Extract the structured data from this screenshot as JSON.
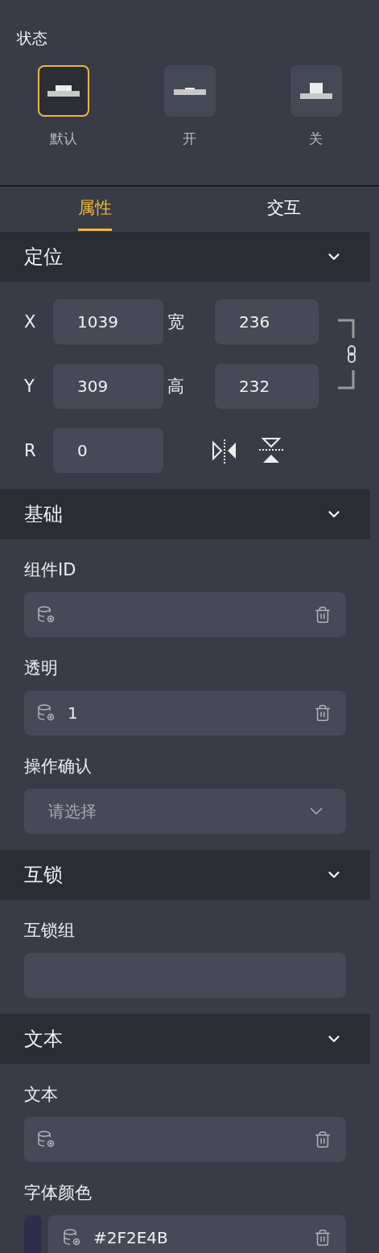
{
  "state_panel": {
    "title": "状态",
    "states": [
      {
        "kind": "default",
        "label": "默认",
        "selected": true
      },
      {
        "kind": "on",
        "label": "开",
        "selected": false
      },
      {
        "kind": "off",
        "label": "关",
        "selected": false
      }
    ]
  },
  "tabs": [
    {
      "label": "属性",
      "selected": true
    },
    {
      "label": "交互",
      "selected": false
    }
  ],
  "position": {
    "title": "定位",
    "expanded": true,
    "fields": [
      {
        "label": "X",
        "value": "1039"
      },
      {
        "label": "宽",
        "value": "236"
      },
      {
        "label": "Y",
        "value": "309"
      },
      {
        "label": "高",
        "value": "232"
      },
      {
        "label": "R",
        "value": "0"
      }
    ]
  },
  "sections": [
    {
      "title": "基础",
      "expanded": true,
      "fields": [
        {
          "kind": "bound",
          "label": "组件ID"
        },
        {
          "kind": "bound",
          "label": "透明",
          "value": "1"
        },
        {
          "kind": "select",
          "label": "操作确认",
          "placeholder": "请选择"
        }
      ]
    },
    {
      "title": "互锁",
      "expanded": true,
      "fields": [
        {
          "kind": "plain",
          "label": "互锁组"
        }
      ]
    },
    {
      "title": "文本",
      "expanded": true,
      "fields": [
        {
          "kind": "bound",
          "label": "文本"
        },
        {
          "kind": "color",
          "label": "字体颜色",
          "value": "#2F2E4B",
          "color": "#2f2e4b"
        }
      ]
    }
  ]
}
